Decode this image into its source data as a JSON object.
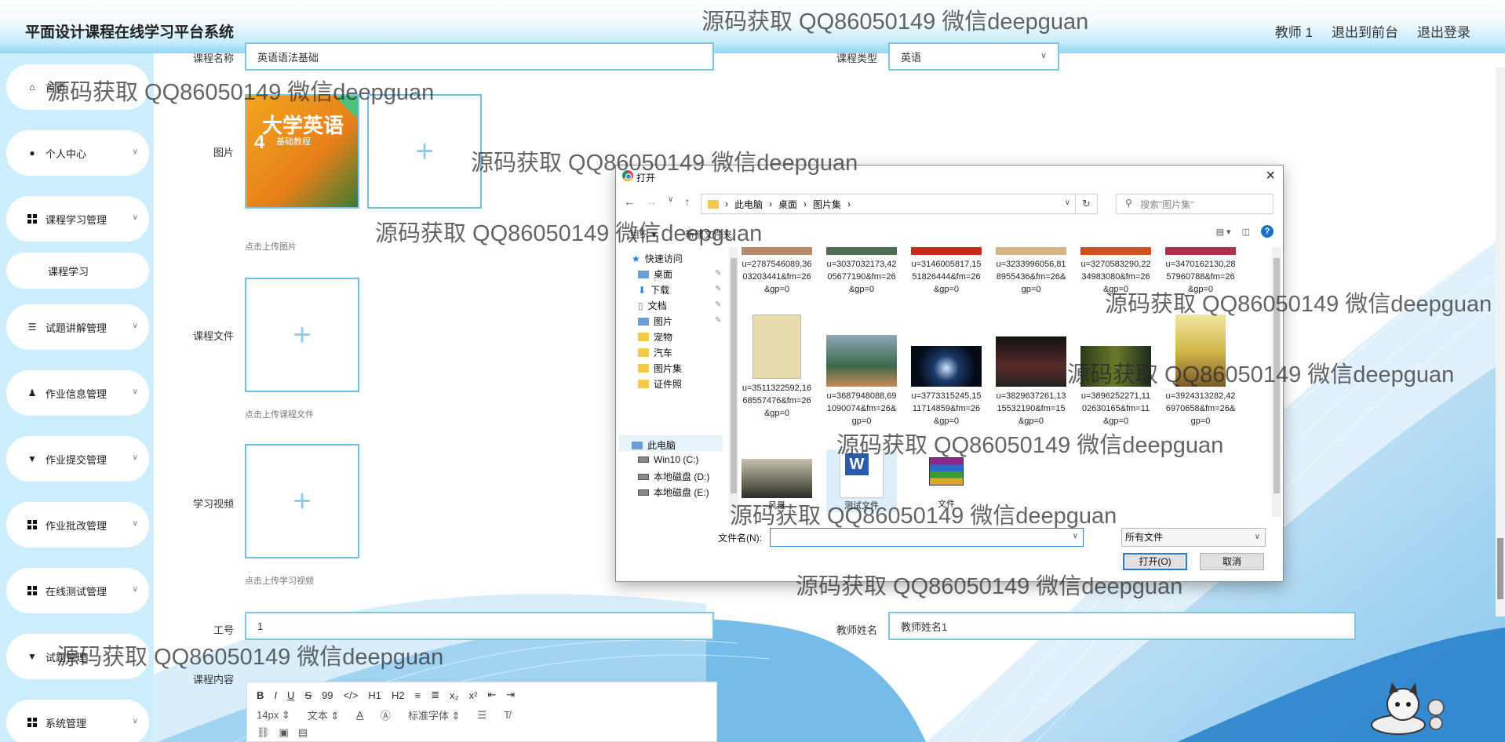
{
  "app": {
    "title": "平面设计课程在线学习平台系统",
    "nav": [
      "教师 1",
      "退出到前台",
      "退出登录"
    ]
  },
  "sidebar": {
    "items": [
      {
        "label": "首页",
        "icon": "home-icon"
      },
      {
        "label": "个人中心",
        "icon": "user-icon"
      },
      {
        "label": "课程学习管理",
        "icon": "grid-icon"
      },
      {
        "label": "课程学习",
        "icon": ""
      },
      {
        "label": "试题讲解管理",
        "icon": "list-icon"
      },
      {
        "label": "作业信息管理",
        "icon": "person-icon"
      },
      {
        "label": "作业提交管理",
        "icon": "cup-icon"
      },
      {
        "label": "作业批改管理",
        "icon": "grid-icon"
      },
      {
        "label": "在线测试管理",
        "icon": "grid-icon"
      },
      {
        "label": "试题管理",
        "icon": "cup-icon"
      },
      {
        "label": "系统管理",
        "icon": "grid-icon"
      }
    ]
  },
  "form": {
    "course_name_label": "课程名称",
    "course_name_value": "英语语法基础",
    "course_type_label": "课程类型",
    "course_type_value": "英语",
    "image_label": "图片",
    "image_hint": "点击上传图片",
    "book_title": "大学英语",
    "book_subtitle": "基础教程",
    "book_num": "4",
    "file_label": "课程文件",
    "file_hint": "点击上传课程文件",
    "video_label": "学习视频",
    "video_hint": "点击上传学习视频",
    "work_id_label": "工号",
    "work_id_value": "1",
    "teacher_label": "教师姓名",
    "teacher_value": "教师姓名1",
    "content_label": "课程内容",
    "plus": "+"
  },
  "editor": {
    "row1": [
      "B",
      "I",
      "U",
      "S",
      "99",
      "</>",
      "H1",
      "H2",
      "≡",
      "≣",
      "x₂",
      "x²",
      "⇤",
      "⇥"
    ],
    "font_size": "14px",
    "text_style": "文本",
    "font_family": "标准字体"
  },
  "dialog": {
    "title": "打开",
    "path": [
      "此电脑",
      "桌面",
      "图片集"
    ],
    "search_placeholder": "搜索\"图片集\"",
    "organize": "组织 ▾",
    "new_folder": "新建文件夹",
    "nav_items": [
      {
        "label": "快速访问",
        "kind": "star"
      },
      {
        "label": "桌面",
        "kind": "desk",
        "pinned": true
      },
      {
        "label": "下载",
        "kind": "down",
        "pinned": true
      },
      {
        "label": "文档",
        "kind": "doc",
        "pinned": true
      },
      {
        "label": "图片",
        "kind": "pic",
        "pinned": true
      },
      {
        "label": "宠物",
        "kind": "folder"
      },
      {
        "label": "汽车",
        "kind": "folder"
      },
      {
        "label": "图片集",
        "kind": "folder"
      },
      {
        "label": "证件照",
        "kind": "folder"
      },
      {
        "label": "此电脑",
        "kind": "pc"
      },
      {
        "label": "Win10 (C:)",
        "kind": "drive"
      },
      {
        "label": "本地磁盘 (D:)",
        "kind": "drive"
      },
      {
        "label": "本地磁盘 (E:)",
        "kind": "drive"
      }
    ],
    "files_row1": [
      "u=2787546089,3603203441&fm=26&gp=0",
      "u=3037032173,4205677190&fm=26&gp=0",
      "u=3146005817,1551826444&fm=26&gp=0",
      "u=3233996056,818955436&fm=26&gp=0",
      "u=3270583290,2234983080&fm=26&gp=0",
      "u=3470162130,2857960788&fm=26&gp=0"
    ],
    "files_row2": [
      "u=3511322592,1668557476&fm=26&gp=0",
      "u=3687948088,691090074&fm=26&gp=0",
      "u=3773315245,1511714859&fm=26&gp=0",
      "u=3829637261,1315532190&fm=15&gp=0",
      "u=3896252271,1102630165&fm=11&gp=0",
      "u=3924313282,426970658&fm=26&gp=0"
    ],
    "files_row3": [
      "风景",
      "测试文件",
      "文件"
    ],
    "filename_label": "文件名(N):",
    "filename_value": "",
    "filetype_value": "所有文件",
    "open_button": "打开(O)",
    "cancel_button": "取消"
  },
  "watermark": "源码获取 QQ86050149 微信deepguan",
  "colors": {
    "header_gradient_end": "#8fd6f5",
    "sidebar_bg": "#cdeefd",
    "input_border": "#7cc6e8",
    "accent": "#2a7fd4"
  }
}
